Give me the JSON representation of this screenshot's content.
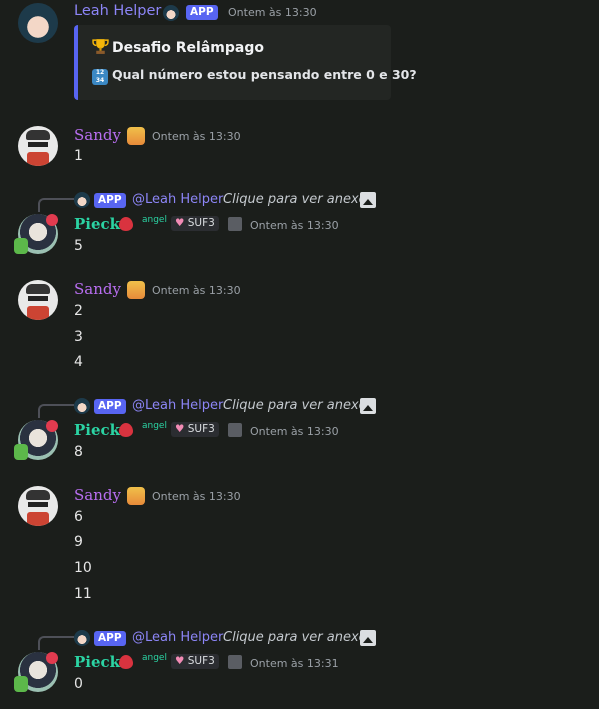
{
  "messages": [
    {
      "author": "Leah Helper",
      "badge": "APP",
      "time": "Ontem às 13:30",
      "embed": {
        "title": "Desafio Relâmpago",
        "description": "Qual número estou pensando entre 0 e 30?",
        "title_icon": "trophy-icon",
        "desc_icon": "numbers-icon"
      }
    },
    {
      "author": "Sandy",
      "time": "Ontem às 13:30",
      "lines": [
        "1"
      ]
    },
    {
      "reply": {
        "badge": "APP",
        "mention": "@Leah Helper",
        "text": "Clique para ver anexo"
      },
      "author": "Pieck",
      "role_tag": "angel",
      "tag": "SUF3",
      "time": "Ontem às 13:30",
      "lines": [
        "5"
      ]
    },
    {
      "author": "Sandy",
      "time": "Ontem às 13:30",
      "lines": [
        "2",
        "3",
        "4"
      ]
    },
    {
      "reply": {
        "badge": "APP",
        "mention": "@Leah Helper",
        "text": "Clique para ver anexo"
      },
      "author": "Pieck",
      "role_tag": "angel",
      "tag": "SUF3",
      "time": "Ontem às 13:30",
      "lines": [
        "8"
      ]
    },
    {
      "author": "Sandy",
      "time": "Ontem às 13:30",
      "lines": [
        "6",
        "9",
        "10",
        "11"
      ]
    },
    {
      "reply": {
        "badge": "APP",
        "mention": "@Leah Helper",
        "text": "Clique para ver anexo"
      },
      "author": "Pieck",
      "role_tag": "angel",
      "tag": "SUF3",
      "time": "Ontem às 13:31",
      "lines": [
        "0"
      ]
    }
  ],
  "colors": {
    "background": "#1b1e1b",
    "app_badge": "#5865f2",
    "leah": "#8c85f6",
    "sandy": "#b86ef0",
    "pieck": "#2bd3a3"
  }
}
